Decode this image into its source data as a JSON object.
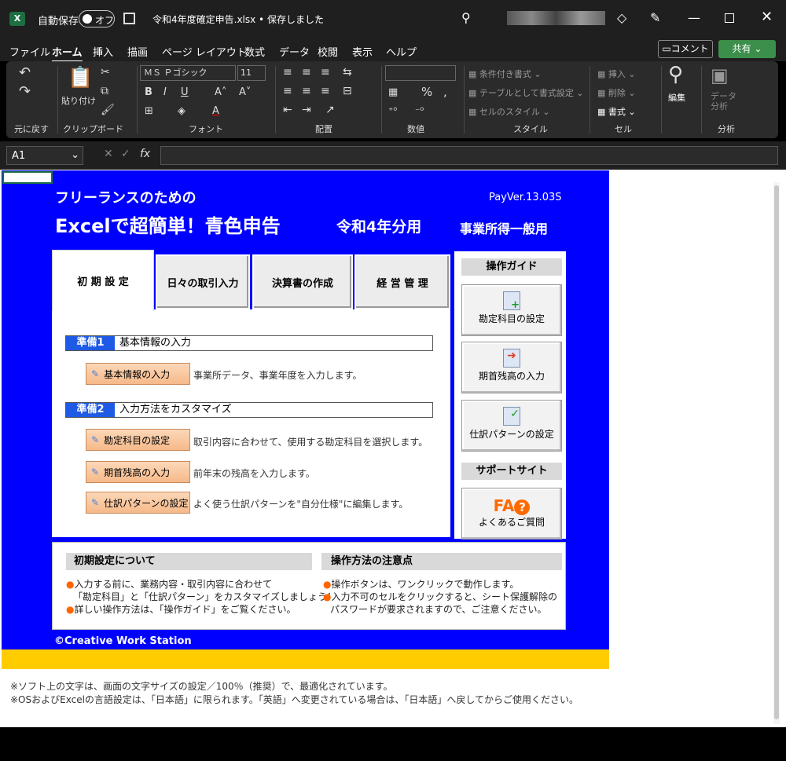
{
  "title": {
    "autosave": "自動保存",
    "toggle": "オフ",
    "filename": "令和4年度確定申告.xlsx • 保存しました"
  },
  "menu": [
    "ファイル",
    "ホーム",
    "挿入",
    "描画",
    "ページ レイアウト",
    "数式",
    "データ",
    "校閲",
    "表示",
    "ヘルプ"
  ],
  "menu_right": {
    "comment": "コメント",
    "share": "共有"
  },
  "ribbon": {
    "undo_group": "元に戻す",
    "paste": "貼り付け",
    "clipboard": "クリップボード",
    "font_name": "ＭＳ Ｐゴシック",
    "font_size": "11",
    "font": "フォント",
    "align": "配置",
    "number": "数値",
    "cond": "条件付き書式",
    "table": "テーブルとして書式設定",
    "cellstyle": "セルのスタイル",
    "style": "スタイル",
    "insert": "挿入",
    "delete": "削除",
    "format": "書式",
    "cell": "セル",
    "edit": "編集",
    "analysis_btn": "データ\n分析",
    "analysis": "分析"
  },
  "formula": {
    "cell": "A1",
    "fx": "fx"
  },
  "app": {
    "subtitle": "フリーランスのための",
    "title": "Excelで超簡単！青色申告",
    "year": "令和4年分用",
    "type": "事業所得一般用",
    "version": "PayVer.13.03S",
    "tabs": [
      "初 期 設 定",
      "日々の取引入力",
      "決算書の作成",
      "経 営 管 理"
    ],
    "steps": [
      {
        "label": "準備1",
        "text": "基本情報の入力"
      },
      {
        "label": "準備2",
        "text": "入力方法をカスタマイズ"
      }
    ],
    "buttons": [
      {
        "label": "基本情報の入力",
        "desc": "事業所データ、事業年度を入力します。"
      },
      {
        "label": "勘定科目の設定",
        "desc": "取引内容に合わせて、使用する勘定科目を選択します。"
      },
      {
        "label": "期首残高の入力",
        "desc": "前年末の残高を入力します。"
      },
      {
        "label": "仕訳パターンの設定",
        "desc": "よく使う仕訳パターンを\"自分仕様\"に編集します。"
      }
    ],
    "guide_title": "操作ガイド",
    "guide": [
      "勘定科目の設定",
      "期首残高の入力",
      "仕訳パターンの設定"
    ],
    "support_title": "サポートサイト",
    "faq_logo": "FA",
    "faq": "よくあるご質問",
    "about_title": "初期設定について",
    "about": [
      "入力する前に、業務内容・取引内容に合わせて",
      "「勘定科目」と「仕訳パターン」をカスタマイズしましょう！",
      "詳しい操作方法は、「操作ガイド」をご覧ください。"
    ],
    "caution_title": "操作方法の注意点",
    "caution": [
      "操作ボタンは、ワンクリックで動作します。",
      "入力不可のセルをクリックすると、シート保護解除の",
      "パスワードが要求されますので、ご注意ください。"
    ],
    "copyright": "©Creative Work Station"
  },
  "footnotes": [
    "※ソフト上の文字は、画面の文字サイズの設定／100％（推奨）で、最適化されています。",
    "※OSおよびExcelの言語設定は、「日本語」に限られます。「英語」へ変更されている場合は、「日本語」へ戻してからご使用ください。"
  ],
  "colors": {
    "banner": "#0000ff",
    "strip": "#ffcc00",
    "button": "#f6b98a",
    "accent": "#1e5ae6"
  }
}
